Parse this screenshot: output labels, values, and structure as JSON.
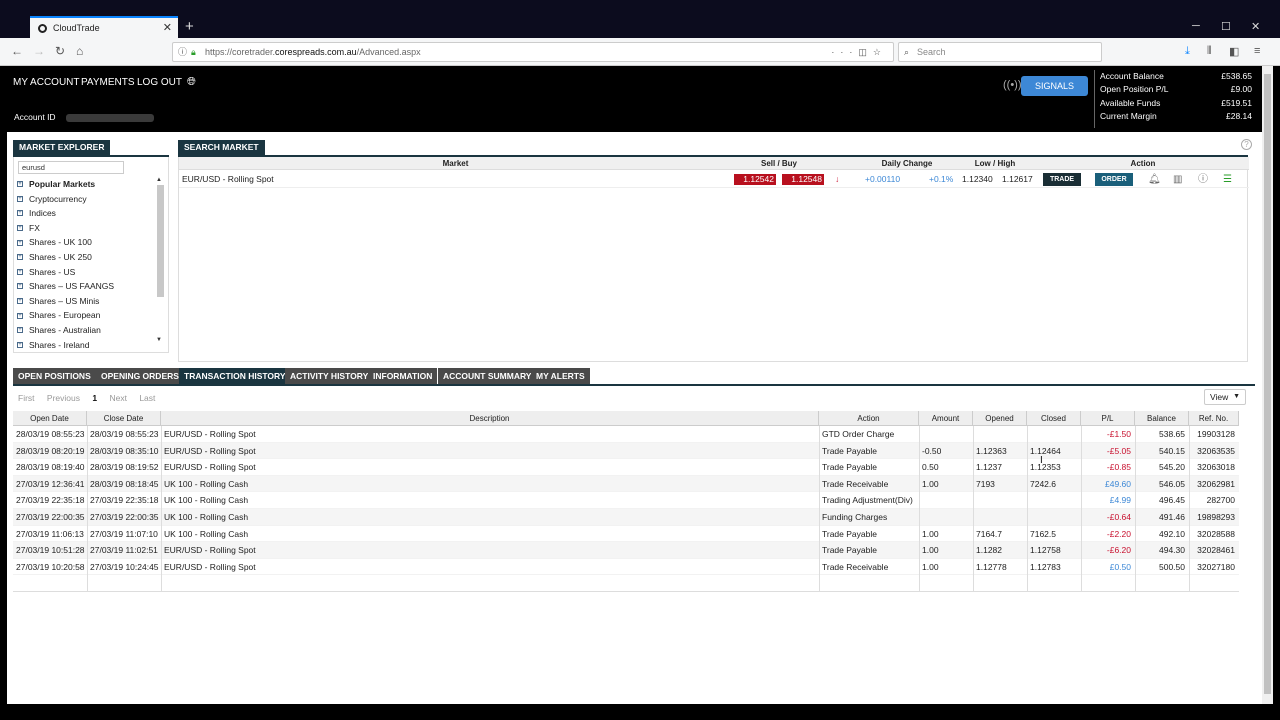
{
  "browser": {
    "tab_title": "CloudTrade",
    "url_prefix": "https://coretrader.",
    "url_domain": "corespreads.com.au",
    "url_path": "/Advanced.aspx",
    "search_placeholder": "Search"
  },
  "header": {
    "nav": [
      "MY ACCOUNT",
      "PAYMENTS",
      "LOG OUT"
    ],
    "account_id_label": "Account ID",
    "signals_label": "SIGNALS",
    "summary": [
      {
        "label": "Account Balance",
        "value": "£538.65"
      },
      {
        "label": "Open Position P/L",
        "value": "£9.00"
      },
      {
        "label": "Available Funds",
        "value": "£519.51"
      },
      {
        "label": "Current Margin",
        "value": "£28.14"
      }
    ]
  },
  "market_explorer": {
    "title": "MARKET EXPLORER",
    "search_value": "eurusd",
    "items": [
      "Popular Markets",
      "Cryptocurrency",
      "Indices",
      "FX",
      "Shares - UK 100",
      "Shares - UK 250",
      "Shares - US",
      "Shares – US FAANGS",
      "Shares – US Minis",
      "Shares - European",
      "Shares - Australian",
      "Shares - Ireland"
    ]
  },
  "search_market": {
    "title": "SEARCH MARKET",
    "headers": {
      "market": "Market",
      "sell_buy": "Sell / Buy",
      "daily_change": "Daily Change",
      "low_high": "Low / High",
      "action": "Action"
    },
    "row": {
      "market": "EUR/USD - Rolling Spot",
      "sell": "1.12542",
      "buy": "1.12548",
      "change": "+0.00110",
      "change_pct": "+0.1%",
      "low": "1.12340",
      "high": "1.12617",
      "trade_label": "TRADE",
      "order_label": "ORDER"
    }
  },
  "bottom_tabs": [
    "OPEN POSITIONS",
    "OPENING ORDERS",
    "TRANSACTION HISTORY",
    "ACTIVITY HISTORY",
    "INFORMATION",
    "ACCOUNT SUMMARY",
    "MY ALERTS"
  ],
  "pager": {
    "first": "First",
    "previous": "Previous",
    "current": "1",
    "next": "Next",
    "last": "Last",
    "view": "View"
  },
  "history": {
    "headers": [
      "Open Date",
      "Close Date",
      "Description",
      "Action",
      "Amount",
      "Opened",
      "Closed",
      "P/L",
      "Balance",
      "Ref. No."
    ],
    "rows": [
      [
        "28/03/19 08:55:23",
        "28/03/19 08:55:23",
        "EUR/USD - Rolling Spot",
        "GTD Order Charge",
        "",
        "",
        "",
        "-£1.50",
        "538.65",
        "19903128"
      ],
      [
        "28/03/19 08:20:19",
        "28/03/19 08:35:10",
        "EUR/USD - Rolling Spot",
        "Trade Payable",
        "-0.50",
        "1.12363",
        "1.12464",
        "-£5.05",
        "540.15",
        "32063535"
      ],
      [
        "28/03/19 08:19:40",
        "28/03/19 08:19:52",
        "EUR/USD - Rolling Spot",
        "Trade Payable",
        "0.50",
        "1.1237",
        "1.12353",
        "-£0.85",
        "545.20",
        "32063018"
      ],
      [
        "27/03/19 12:36:41",
        "28/03/19 08:18:45",
        "UK 100 - Rolling Cash",
        "Trade Receivable",
        "1.00",
        "7193",
        "7242.6",
        "£49.60",
        "546.05",
        "32062981"
      ],
      [
        "27/03/19 22:35:18",
        "27/03/19 22:35:18",
        "UK 100 - Rolling Cash",
        "Trading Adjustment(Div)",
        "",
        "",
        "",
        "£4.99",
        "496.45",
        "282700"
      ],
      [
        "27/03/19 22:00:35",
        "27/03/19 22:00:35",
        "UK 100 - Rolling Cash",
        "Funding Charges",
        "",
        "",
        "",
        "-£0.64",
        "491.46",
        "19898293"
      ],
      [
        "27/03/19 11:06:13",
        "27/03/19 11:07:10",
        "UK 100 - Rolling Cash",
        "Trade Payable",
        "1.00",
        "7164.7",
        "7162.5",
        "-£2.20",
        "492.10",
        "32028588"
      ],
      [
        "27/03/19 10:51:28",
        "27/03/19 11:02:51",
        "EUR/USD - Rolling Spot",
        "Trade Payable",
        "1.00",
        "1.1282",
        "1.12758",
        "-£6.20",
        "494.30",
        "32028461"
      ],
      [
        "27/03/19 10:20:58",
        "27/03/19 10:24:45",
        "EUR/USD - Rolling Spot",
        "Trade Receivable",
        "1.00",
        "1.12778",
        "1.12783",
        "£0.50",
        "500.50",
        "32027180"
      ]
    ]
  },
  "colors": {
    "negative": "#c8102e",
    "positive": "#3d88d6",
    "panel_header": "#1a3540",
    "signals": "#3d88d6"
  }
}
